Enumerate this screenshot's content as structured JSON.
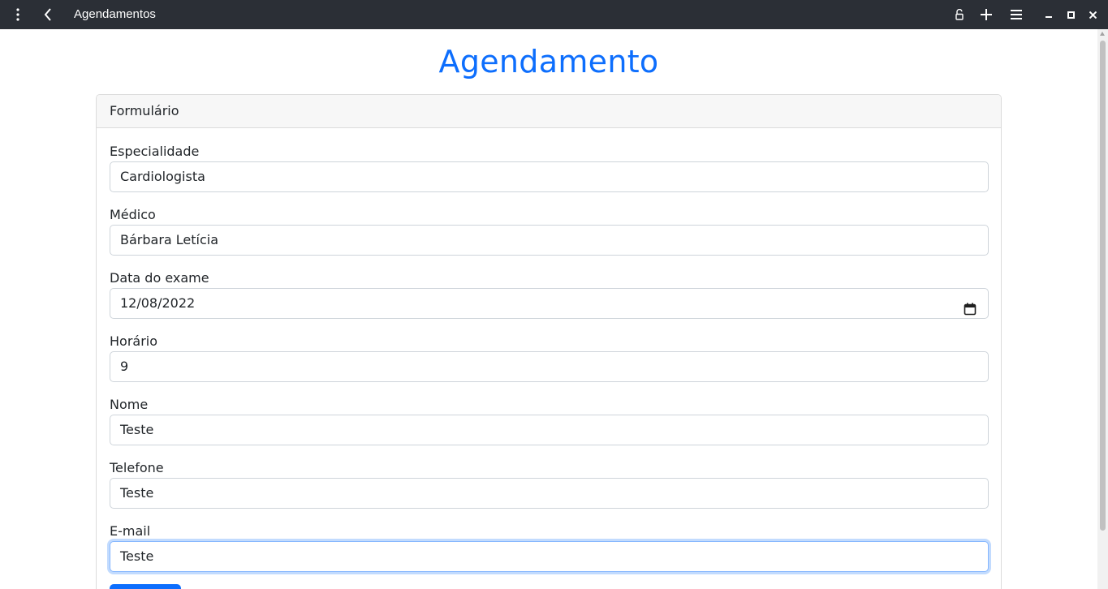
{
  "window": {
    "title": "Agendamentos"
  },
  "icons": {
    "menu": "vertical-dots-icon",
    "back": "chevron-left-icon",
    "lock": "unlock-icon",
    "add": "plus-icon",
    "hamburger": "hamburger-icon",
    "minimize": "minimize-icon",
    "maximize": "maximize-icon",
    "close": "close-icon",
    "calendar": "calendar-icon"
  },
  "colors": {
    "accent": "#0d6efd",
    "titlebar": "#2b2f36",
    "focus_ring": "#86b7fe"
  },
  "page": {
    "heading": "Agendamento"
  },
  "form": {
    "header": "Formulário",
    "fields": [
      {
        "label": "Especialidade",
        "value": "Cardiologista"
      },
      {
        "label": "Médico",
        "value": "Bárbara Letícia"
      },
      {
        "label": "Data do exame",
        "value": "12/08/2022"
      },
      {
        "label": "Horário",
        "value": "9"
      },
      {
        "label": "Nome",
        "value": "Teste"
      },
      {
        "label": "Telefone",
        "value": "Teste"
      },
      {
        "label": "E-mail",
        "value": "Teste"
      }
    ]
  }
}
